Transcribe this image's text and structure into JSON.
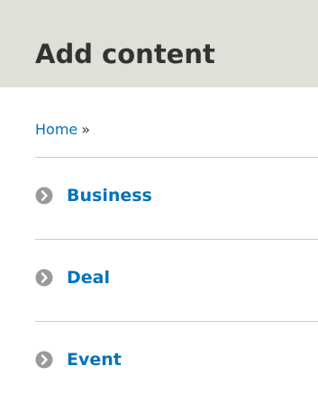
{
  "page": {
    "title": "Add content"
  },
  "breadcrumb": {
    "home_label": "Home",
    "separator": "»"
  },
  "content_types": [
    {
      "label": "Business",
      "icon": "chevron-right-circle-icon"
    },
    {
      "label": "Deal",
      "icon": "chevron-right-circle-icon"
    },
    {
      "label": "Event",
      "icon": "chevron-right-circle-icon"
    }
  ],
  "colors": {
    "header_background": "#e0e0d8",
    "link": "#0074bd",
    "title_text": "#333333",
    "icon": "#9a9a9a",
    "divider": "#cccccc"
  }
}
